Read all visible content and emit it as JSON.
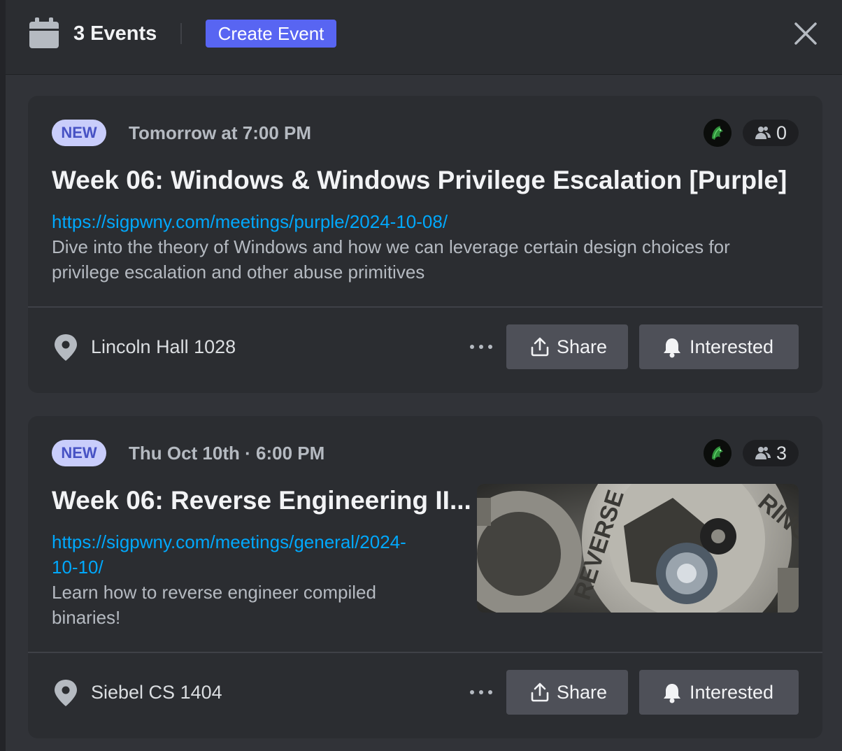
{
  "header": {
    "events_count": "3 Events",
    "create_event_label": "Create Event"
  },
  "events": [
    {
      "badge": "NEW",
      "time": "Tomorrow at 7:00 PM",
      "interested_count": "0",
      "title": "Week 06: Windows & Windows Privilege Escalation [Purple]",
      "link": "https://sigpwny.com/meetings/purple/2024-10-08/",
      "description_line1": "Dive into the theory of Windows and how we can leverage certain design choices for",
      "description_line2": "privilege escalation and other abuse primitives",
      "location": "Lincoln Hall 1028",
      "share_label": "Share",
      "interested_label": "Interested"
    },
    {
      "badge": "NEW",
      "time": "Thu Oct 10th · 6:00 PM",
      "interested_count": "3",
      "title": "Week 06: Reverse Engineering II...",
      "link_line1": "https://sigpwny.com/meetings/general/2024-",
      "link_line2": "10-10/",
      "description_line1": "Learn how to reverse engineer compiled",
      "description_line2": "binaries!",
      "location": "Siebel CS 1404",
      "share_label": "Share",
      "interested_label": "Interested",
      "image_text_left": "REVERSE",
      "image_text_right": "RING"
    }
  ],
  "colors": {
    "accent": "#5865f2",
    "badge_bg": "#c9cdfb",
    "badge_text": "#4752c4",
    "link": "#00a8fc"
  },
  "icons": [
    "calendar-icon",
    "close-icon",
    "guild-avatar-icon",
    "users-icon",
    "location-pin-icon",
    "more-dots-icon",
    "share-icon",
    "bell-icon"
  ]
}
